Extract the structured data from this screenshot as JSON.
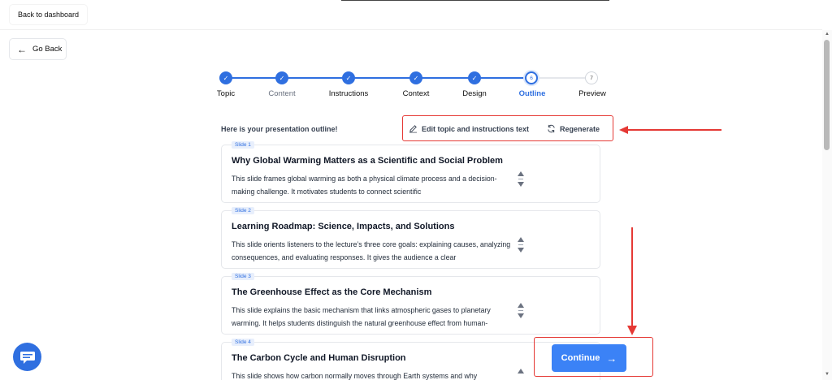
{
  "topbar": {
    "back_to_dashboard": "Back to dashboard"
  },
  "nav": {
    "go_back": "Go Back"
  },
  "stepper": {
    "steps": [
      {
        "label": "Topic",
        "state": "done"
      },
      {
        "label": "Content",
        "state": "done"
      },
      {
        "label": "Instructions",
        "state": "done"
      },
      {
        "label": "Context",
        "state": "done"
      },
      {
        "label": "Design",
        "state": "done"
      },
      {
        "label": "Outline",
        "state": "current",
        "number": "6"
      },
      {
        "label": "Preview",
        "state": "todo",
        "number": "7"
      }
    ]
  },
  "outline": {
    "heading": "Here is your presentation outline!",
    "edit_label": "Edit topic and instructions text",
    "regenerate_label": "Regenerate"
  },
  "slides": [
    {
      "badge": "Slide 1",
      "title": "Why Global Warming Matters as a Scientific and Social Problem",
      "description": "This slide frames global warming as both a physical climate process and a decision-making challenge. It motivates students to connect scientific"
    },
    {
      "badge": "Slide 2",
      "title": "Learning Roadmap: Science, Impacts, and Solutions",
      "description": "This slide orients listeners to the lecture’s three core goals: explaining causes, analyzing consequences, and evaluating responses. It gives the audience a clear"
    },
    {
      "badge": "Slide 3",
      "title": "The Greenhouse Effect as the Core Mechanism",
      "description": "This slide explains the basic mechanism that links atmospheric gases to planetary warming. It helps students distinguish the natural greenhouse effect from human-"
    },
    {
      "badge": "Slide 4",
      "title": "The Carbon Cycle and Human Disruption",
      "description": "This slide shows how carbon normally moves through Earth systems and why"
    }
  ],
  "footer": {
    "continue_label": "Continue"
  },
  "colors": {
    "primary": "#2f6fe0",
    "annotation": "#e53935",
    "button": "#3b82f6"
  }
}
